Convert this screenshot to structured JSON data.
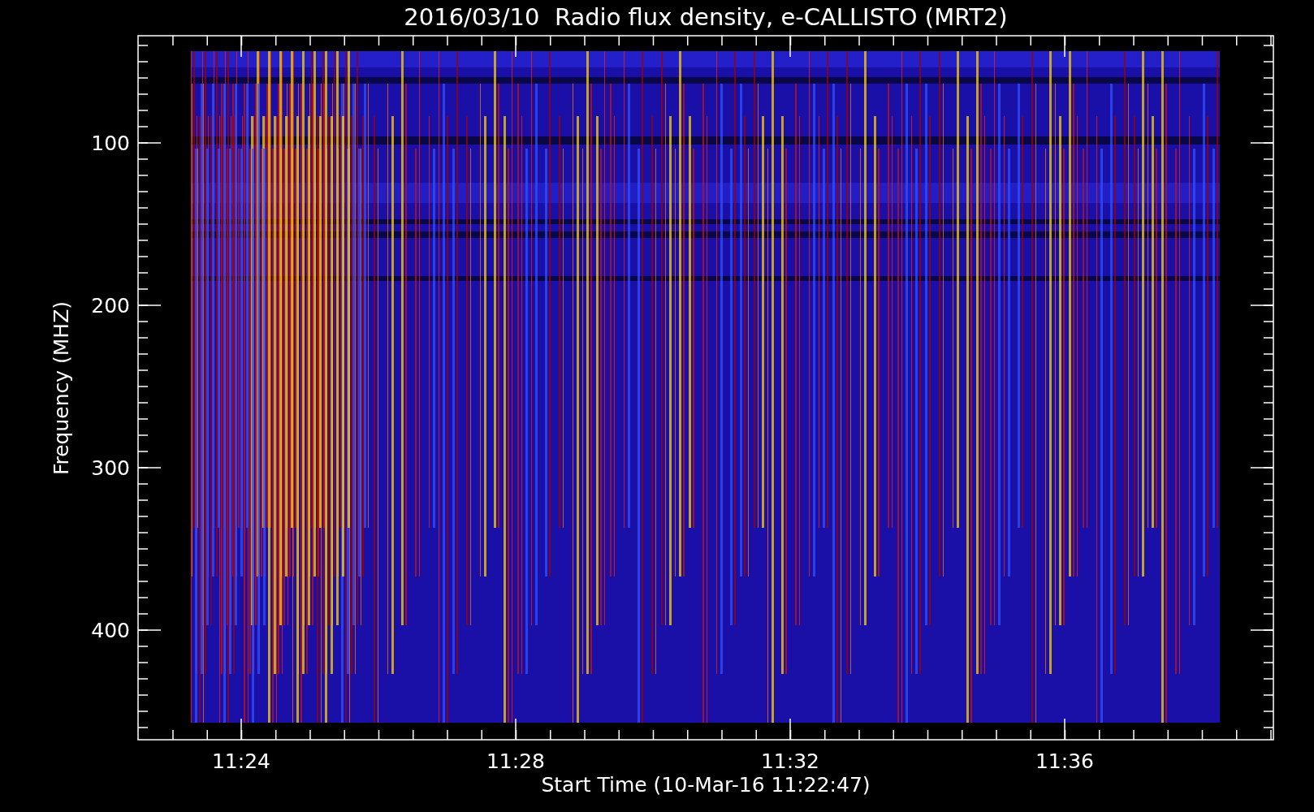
{
  "title": "2016/03/10  Radio flux density, e-CALLISTO (MRT2)",
  "y_axis": {
    "label": "Frequency (MHZ)",
    "ticks": [
      "100",
      "200",
      "300",
      "400"
    ]
  },
  "x_axis": {
    "label": "Start Time (10-Mar-16 11:22:47)",
    "ticks": [
      "11:24",
      "11:28",
      "11:32",
      "11:36"
    ]
  }
}
